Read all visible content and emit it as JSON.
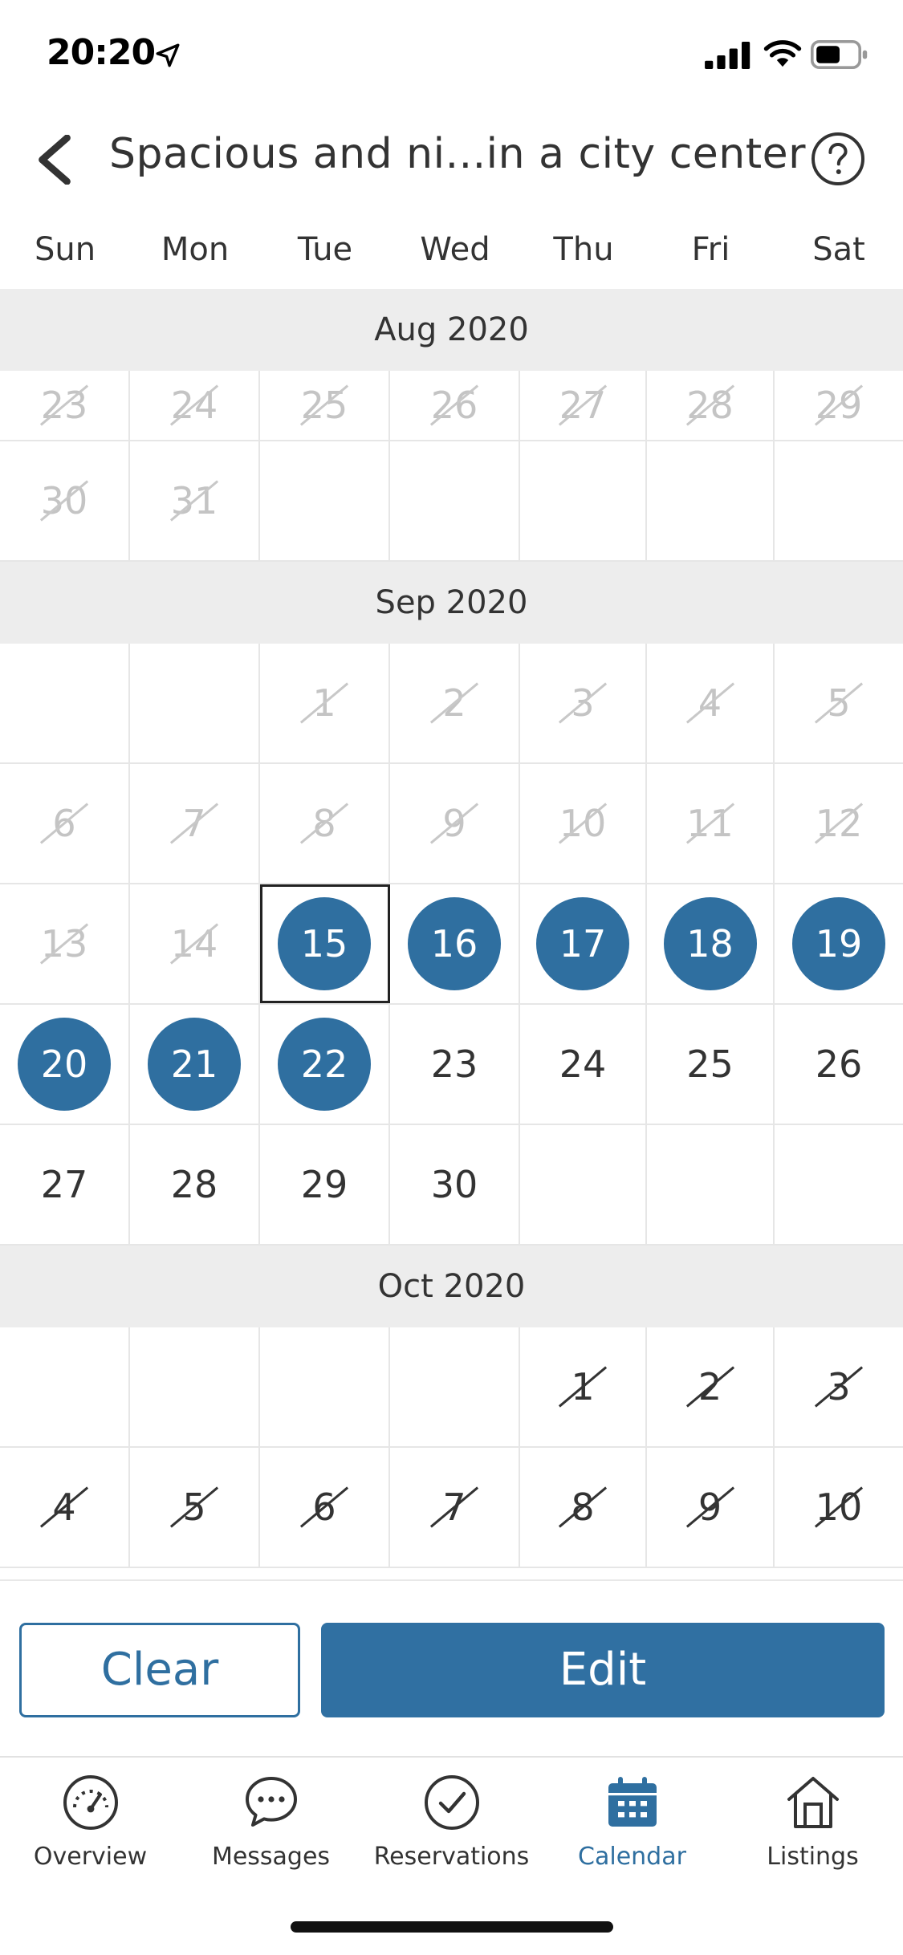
{
  "status_bar": {
    "time": "20:20",
    "icons": [
      "location-arrow-icon",
      "cellular-signal-icon",
      "wifi-icon",
      "battery-icon"
    ]
  },
  "header": {
    "title": "Spacious and ni...in a city center",
    "back_icon": "chevron-left-icon",
    "help_icon": "question-circle-icon"
  },
  "weekdays": [
    "Sun",
    "Mon",
    "Tue",
    "Wed",
    "Thu",
    "Fri",
    "Sat"
  ],
  "months": [
    {
      "label": "Aug 2020"
    },
    {
      "label": "Sep 2020"
    },
    {
      "label": "Oct 2020"
    }
  ],
  "weeks": {
    "aug_w5": [
      {
        "d": "23",
        "s": "blocked-light"
      },
      {
        "d": "24",
        "s": "blocked-light"
      },
      {
        "d": "25",
        "s": "blocked-light"
      },
      {
        "d": "26",
        "s": "blocked-light"
      },
      {
        "d": "27",
        "s": "blocked-light"
      },
      {
        "d": "28",
        "s": "blocked-light"
      },
      {
        "d": "29",
        "s": "blocked-light"
      }
    ],
    "aug_w6": [
      {
        "d": "30",
        "s": "blocked-light"
      },
      {
        "d": "31",
        "s": "blocked-light"
      },
      {
        "d": "",
        "s": "empty"
      },
      {
        "d": "",
        "s": "empty"
      },
      {
        "d": "",
        "s": "empty"
      },
      {
        "d": "",
        "s": "empty"
      },
      {
        "d": "",
        "s": "empty"
      }
    ],
    "sep_w1": [
      {
        "d": "",
        "s": "empty"
      },
      {
        "d": "",
        "s": "empty"
      },
      {
        "d": "1",
        "s": "blocked-light"
      },
      {
        "d": "2",
        "s": "blocked-light"
      },
      {
        "d": "3",
        "s": "blocked-light"
      },
      {
        "d": "4",
        "s": "blocked-light"
      },
      {
        "d": "5",
        "s": "blocked-light"
      }
    ],
    "sep_w2": [
      {
        "d": "6",
        "s": "blocked-light"
      },
      {
        "d": "7",
        "s": "blocked-light"
      },
      {
        "d": "8",
        "s": "blocked-light"
      },
      {
        "d": "9",
        "s": "blocked-light"
      },
      {
        "d": "10",
        "s": "blocked-light"
      },
      {
        "d": "11",
        "s": "blocked-light"
      },
      {
        "d": "12",
        "s": "blocked-light"
      }
    ],
    "sep_w3": [
      {
        "d": "13",
        "s": "blocked-light"
      },
      {
        "d": "14",
        "s": "blocked-light"
      },
      {
        "d": "15",
        "s": "selected-today"
      },
      {
        "d": "16",
        "s": "selected"
      },
      {
        "d": "17",
        "s": "selected"
      },
      {
        "d": "18",
        "s": "selected"
      },
      {
        "d": "19",
        "s": "selected"
      }
    ],
    "sep_w4": [
      {
        "d": "20",
        "s": "selected"
      },
      {
        "d": "21",
        "s": "selected"
      },
      {
        "d": "22",
        "s": "selected"
      },
      {
        "d": "23",
        "s": "available"
      },
      {
        "d": "24",
        "s": "available"
      },
      {
        "d": "25",
        "s": "available"
      },
      {
        "d": "26",
        "s": "available"
      }
    ],
    "sep_w5": [
      {
        "d": "27",
        "s": "available"
      },
      {
        "d": "28",
        "s": "available"
      },
      {
        "d": "29",
        "s": "available"
      },
      {
        "d": "30",
        "s": "available"
      },
      {
        "d": "",
        "s": "empty"
      },
      {
        "d": "",
        "s": "empty"
      },
      {
        "d": "",
        "s": "empty"
      }
    ],
    "oct_w1": [
      {
        "d": "",
        "s": "empty"
      },
      {
        "d": "",
        "s": "empty"
      },
      {
        "d": "",
        "s": "empty"
      },
      {
        "d": "",
        "s": "empty"
      },
      {
        "d": "1",
        "s": "blocked-dark"
      },
      {
        "d": "2",
        "s": "blocked-dark"
      },
      {
        "d": "3",
        "s": "blocked-dark"
      }
    ],
    "oct_w2": [
      {
        "d": "4",
        "s": "blocked-dark"
      },
      {
        "d": "5",
        "s": "blocked-dark"
      },
      {
        "d": "6",
        "s": "blocked-dark"
      },
      {
        "d": "7",
        "s": "blocked-dark"
      },
      {
        "d": "8",
        "s": "blocked-dark"
      },
      {
        "d": "9",
        "s": "blocked-dark"
      },
      {
        "d": "10",
        "s": "blocked-dark"
      }
    ]
  },
  "actions": {
    "clear_label": "Clear",
    "edit_label": "Edit"
  },
  "tabs": [
    {
      "label": "Overview",
      "icon": "gauge-icon",
      "active": false
    },
    {
      "label": "Messages",
      "icon": "chat-bubble-icon",
      "active": false
    },
    {
      "label": "Reservations",
      "icon": "check-circle-icon",
      "active": false
    },
    {
      "label": "Calendar",
      "icon": "calendar-icon",
      "active": true
    },
    {
      "label": "Listings",
      "icon": "house-icon",
      "active": false
    }
  ],
  "colors": {
    "accent": "#2f6fa0",
    "month_header_bg": "#ededed",
    "blocked_text": "#c4c4c4"
  }
}
